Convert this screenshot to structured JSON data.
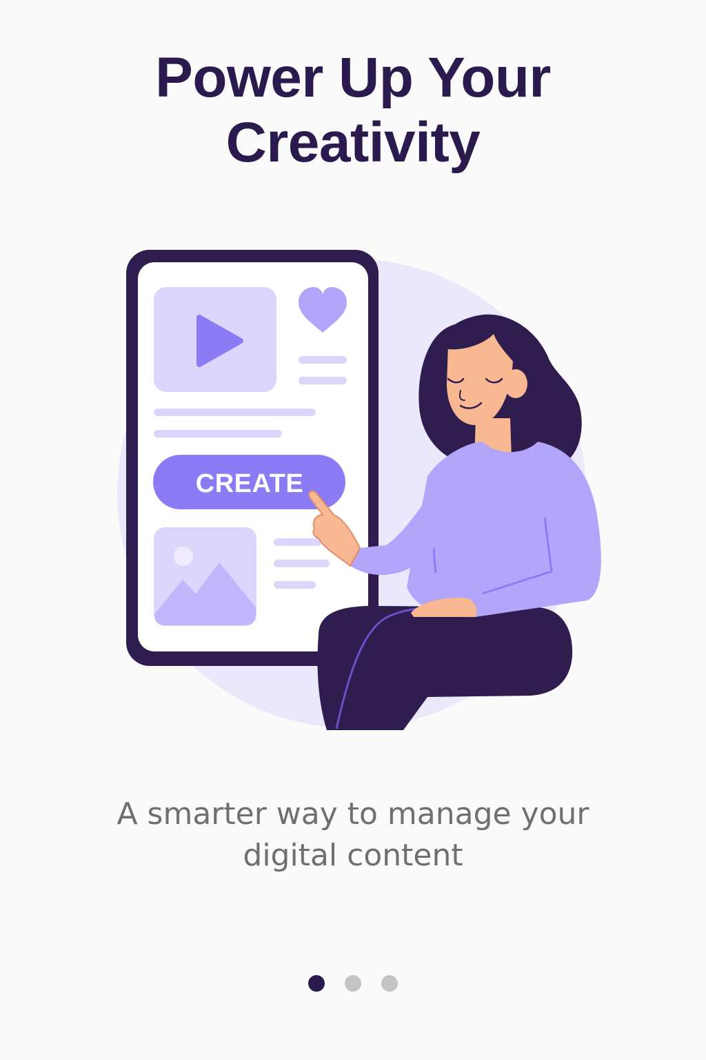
{
  "onboarding": {
    "title_line1": "Power Up Your",
    "title_line2": "Creativity",
    "subtitle_line1": "A smarter way to manage your",
    "subtitle_line2": "digital content",
    "illustration": {
      "create_button_label": "CREATE",
      "icons": [
        "play-icon",
        "heart-icon",
        "image-icon"
      ]
    },
    "pagination": {
      "total_pages": 3,
      "active_page": 1
    }
  },
  "colors": {
    "background": "#fafafa",
    "title": "#2a1a4e",
    "accent": "#8b7cf6",
    "accent_light": "#ddd6fc",
    "phone_frame": "#2f1d4f",
    "subtitle": "#6f6f73",
    "dot_inactive": "#c4c4c6",
    "dot_active": "#2a1a4e"
  }
}
